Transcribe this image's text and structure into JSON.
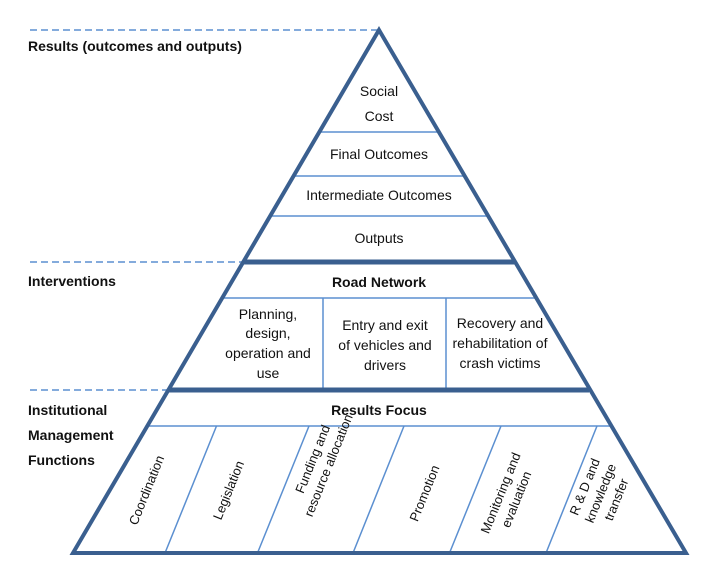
{
  "levels": {
    "results": "Results (outcomes and outputs)",
    "interventions": "Interventions",
    "institutional": [
      "Institutional",
      "Management",
      "Functions"
    ]
  },
  "results_tiers": {
    "social_cost": [
      "Social",
      "Cost"
    ],
    "final_outcomes": "Final Outcomes",
    "intermediate_outcomes": "Intermediate Outcomes",
    "outputs": "Outputs"
  },
  "interventions": {
    "header": "Road Network",
    "cells": [
      [
        "Planning,",
        "design,",
        "operation and",
        "use"
      ],
      [
        "Entry and exit",
        "of vehicles and",
        "drivers"
      ],
      [
        "Recovery and",
        "rehabilitation of",
        "crash victims"
      ]
    ]
  },
  "institutional": {
    "header": "Results Focus",
    "functions": [
      [
        "Coordination"
      ],
      [
        "Legislation"
      ],
      [
        "Funding and",
        "resource allocation"
      ],
      [
        "Promotion"
      ],
      [
        "Monitoring and",
        "evaluation"
      ],
      [
        "R & D and",
        "knowledge",
        "transfer"
      ]
    ]
  },
  "colors": {
    "outline": "#3a5f8f",
    "inner_line": "#5b8fd0",
    "dashed": "#5b8fd0"
  }
}
